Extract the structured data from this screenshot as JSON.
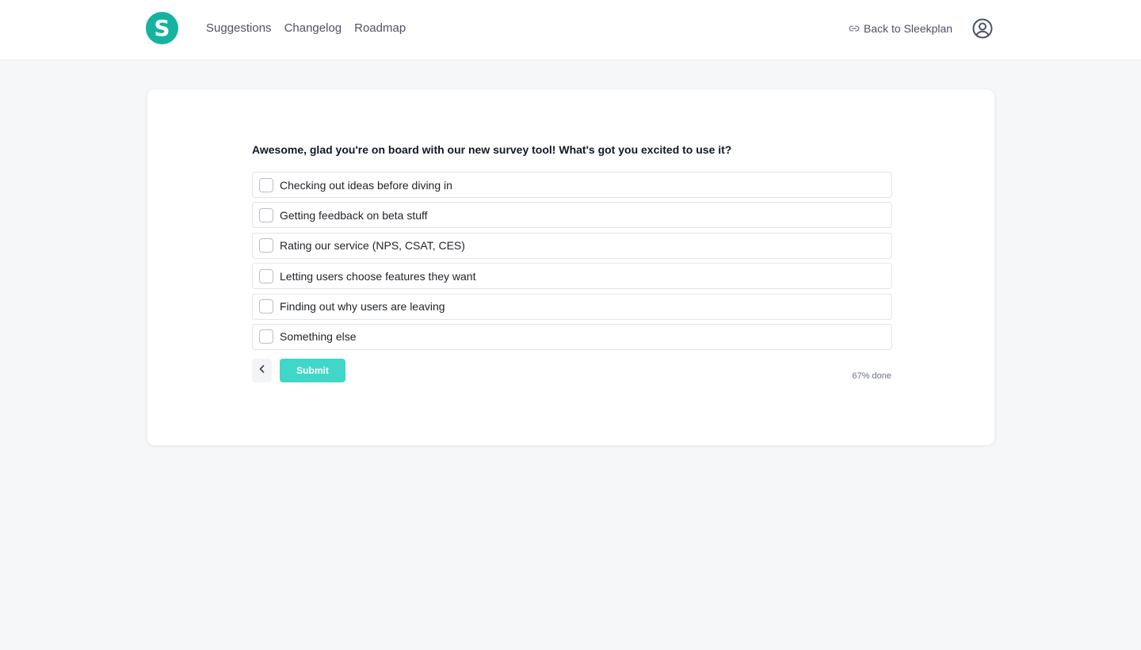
{
  "header": {
    "logo_letter": "S",
    "nav": [
      {
        "label": "Suggestions"
      },
      {
        "label": "Changelog"
      },
      {
        "label": "Roadmap"
      }
    ],
    "back_link_label": "Back to Sleekplan"
  },
  "survey": {
    "question": "Awesome, glad you're on board with our new survey tool! What's got you excited to use it?",
    "options": [
      {
        "label": "Checking out ideas before diving in",
        "checked": false
      },
      {
        "label": "Getting feedback on beta stuff",
        "checked": false
      },
      {
        "label": "Rating our service (NPS, CSAT, CES)",
        "checked": false
      },
      {
        "label": "Letting users choose features they want",
        "checked": false
      },
      {
        "label": "Finding out why users are leaving",
        "checked": false
      },
      {
        "label": "Something else",
        "checked": false
      }
    ],
    "submit_label": "Submit",
    "progress_text": "67% done",
    "progress_percent": 67
  },
  "colors": {
    "brand": "#14b3a0",
    "submit_bg": "#40d7c9",
    "page_bg": "#f6f7f9"
  },
  "icons": {
    "back_link": "link-icon",
    "avatar": "user-circle-icon",
    "back_button": "chevron-left-icon"
  }
}
